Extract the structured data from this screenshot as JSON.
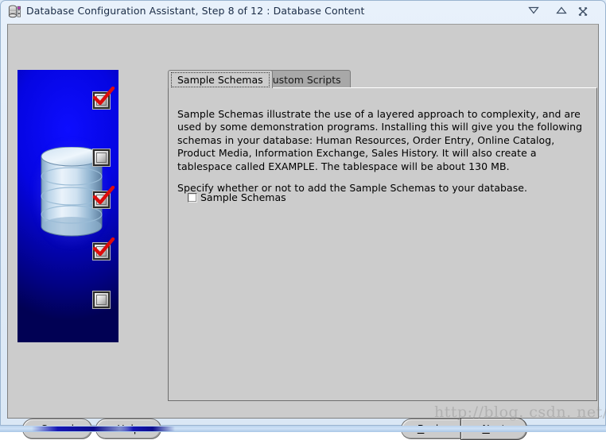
{
  "window": {
    "title": "Database Configuration Assistant, Step 8 of 12 : Database Content",
    "icon": "database-app-icon",
    "controls": {
      "minimize": "minimize-icon",
      "maximize": "maximize-icon",
      "close": "close-icon"
    }
  },
  "sidebar": {
    "illustration": "database-cylinder-illustration",
    "background_color": "#0505e2",
    "markers": [
      {
        "state": "checked",
        "label": "step-marker-1"
      },
      {
        "state": "unchecked",
        "label": "step-marker-2"
      },
      {
        "state": "checked",
        "label": "step-marker-3"
      },
      {
        "state": "checked",
        "label": "step-marker-4"
      },
      {
        "state": "unchecked",
        "label": "step-marker-5"
      }
    ]
  },
  "tabs": [
    {
      "label": "Sample Schemas",
      "active": true
    },
    {
      "label": "Custom Scripts",
      "active": false
    }
  ],
  "content": {
    "paragraph1": "Sample Schemas illustrate the use of a layered approach to complexity, and are used by some demonstration programs. Installing this will give you the following schemas in your database: Human Resources, Order Entry, Online Catalog, Product Media, Information Exchange, Sales History. It will also create a tablespace called EXAMPLE. The tablespace will be about 130 MB.",
    "paragraph2": "Specify whether or not to add the Sample Schemas to your database.",
    "checkbox": {
      "label": "Sample Schemas",
      "checked": false
    }
  },
  "buttons": {
    "cancel": "Cancel",
    "help": "Help",
    "back": "Back",
    "back_mnemonic": "B",
    "back_prefix": "",
    "back_suffix": "ack",
    "next": "Next",
    "next_mnemonic": "N",
    "next_suffix": "ext",
    "back_icon": "double-chevron-left-icon",
    "next_icon": "double-chevron-right-icon"
  },
  "watermark": {
    "text": "http://blog. csdn. net/"
  },
  "colors": {
    "dialog_background": "#cccccc",
    "titlebar_background": "#dce9f7",
    "active_tab": "#cccccc",
    "inactive_tab": "#a8a8a8",
    "sidebar_blue": "#0505e2",
    "check_red": "#e01010"
  }
}
